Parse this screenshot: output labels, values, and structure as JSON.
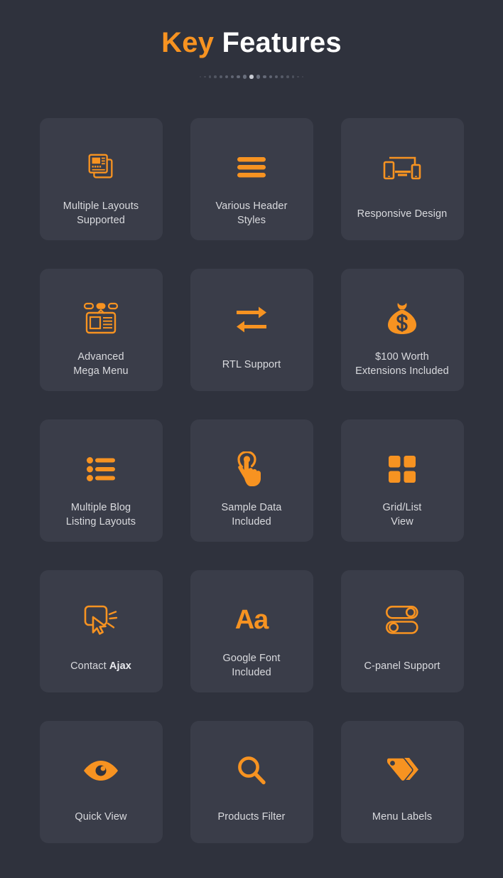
{
  "header": {
    "title_accent": "Key",
    "title_rest": " Features",
    "divider": "dot-divider",
    "dot_count": 19
  },
  "theme": {
    "page_background": "#2f323d",
    "card_background": "#3a3d49",
    "accent": "#f79321",
    "text": "#d9dade",
    "heading_white": "#ffffff",
    "dot_color": "#6f7482"
  },
  "features": [
    {
      "id": "multiple-layouts-supported",
      "icon": "newspaper-layout-icon",
      "label": "Multiple Layouts\nSupported",
      "lines": 2
    },
    {
      "id": "various-header-styles",
      "icon": "hamburger-menu-icon",
      "label": "Various Header\nStyles",
      "lines": 2
    },
    {
      "id": "responsive-design",
      "icon": "responsive-devices-icon",
      "label": "Responsive Design",
      "lines": 1
    },
    {
      "id": "advanced-mega-menu",
      "icon": "mega-menu-icon",
      "label": "Advanced\nMega Menu",
      "lines": 2
    },
    {
      "id": "rtl-support",
      "icon": "exchange-arrows-icon",
      "label": "RTL Support",
      "lines": 1
    },
    {
      "id": "extensions-included",
      "icon": "money-bag-icon",
      "label": "$100 Worth\nExtensions Included",
      "lines": 2
    },
    {
      "id": "multiple-blog-listing-layouts",
      "icon": "bullet-list-icon",
      "label": "Multiple Blog\nListing Layouts",
      "lines": 2
    },
    {
      "id": "sample-data-included",
      "icon": "tap-hand-icon",
      "label": "Sample Data\nIncluded",
      "lines": 2
    },
    {
      "id": "grid-list-view",
      "icon": "grid-squares-icon",
      "label": "Grid/List\nView",
      "lines": 2
    },
    {
      "id": "contact-ajax",
      "icon": "click-cursor-icon",
      "label_parts": [
        {
          "text": "Contact ",
          "bold": false
        },
        {
          "text": "Ajax",
          "bold": true
        }
      ],
      "lines": 1
    },
    {
      "id": "google-font-included",
      "icon": "aa-typography-glyph",
      "glyph": "Aa",
      "label": "Google Font\nIncluded",
      "lines": 2
    },
    {
      "id": "c-panel-support",
      "icon": "toggle-switches-icon",
      "label": "C-panel Support",
      "lines": 1
    },
    {
      "id": "quick-view",
      "icon": "eye-icon",
      "label": "Quick View",
      "lines": 1
    },
    {
      "id": "products-filter",
      "icon": "magnifier-search-icon",
      "label": "Products Filter",
      "lines": 1
    },
    {
      "id": "menu-labels",
      "icon": "price-tags-icon",
      "label": "Menu Labels",
      "lines": 1
    }
  ]
}
